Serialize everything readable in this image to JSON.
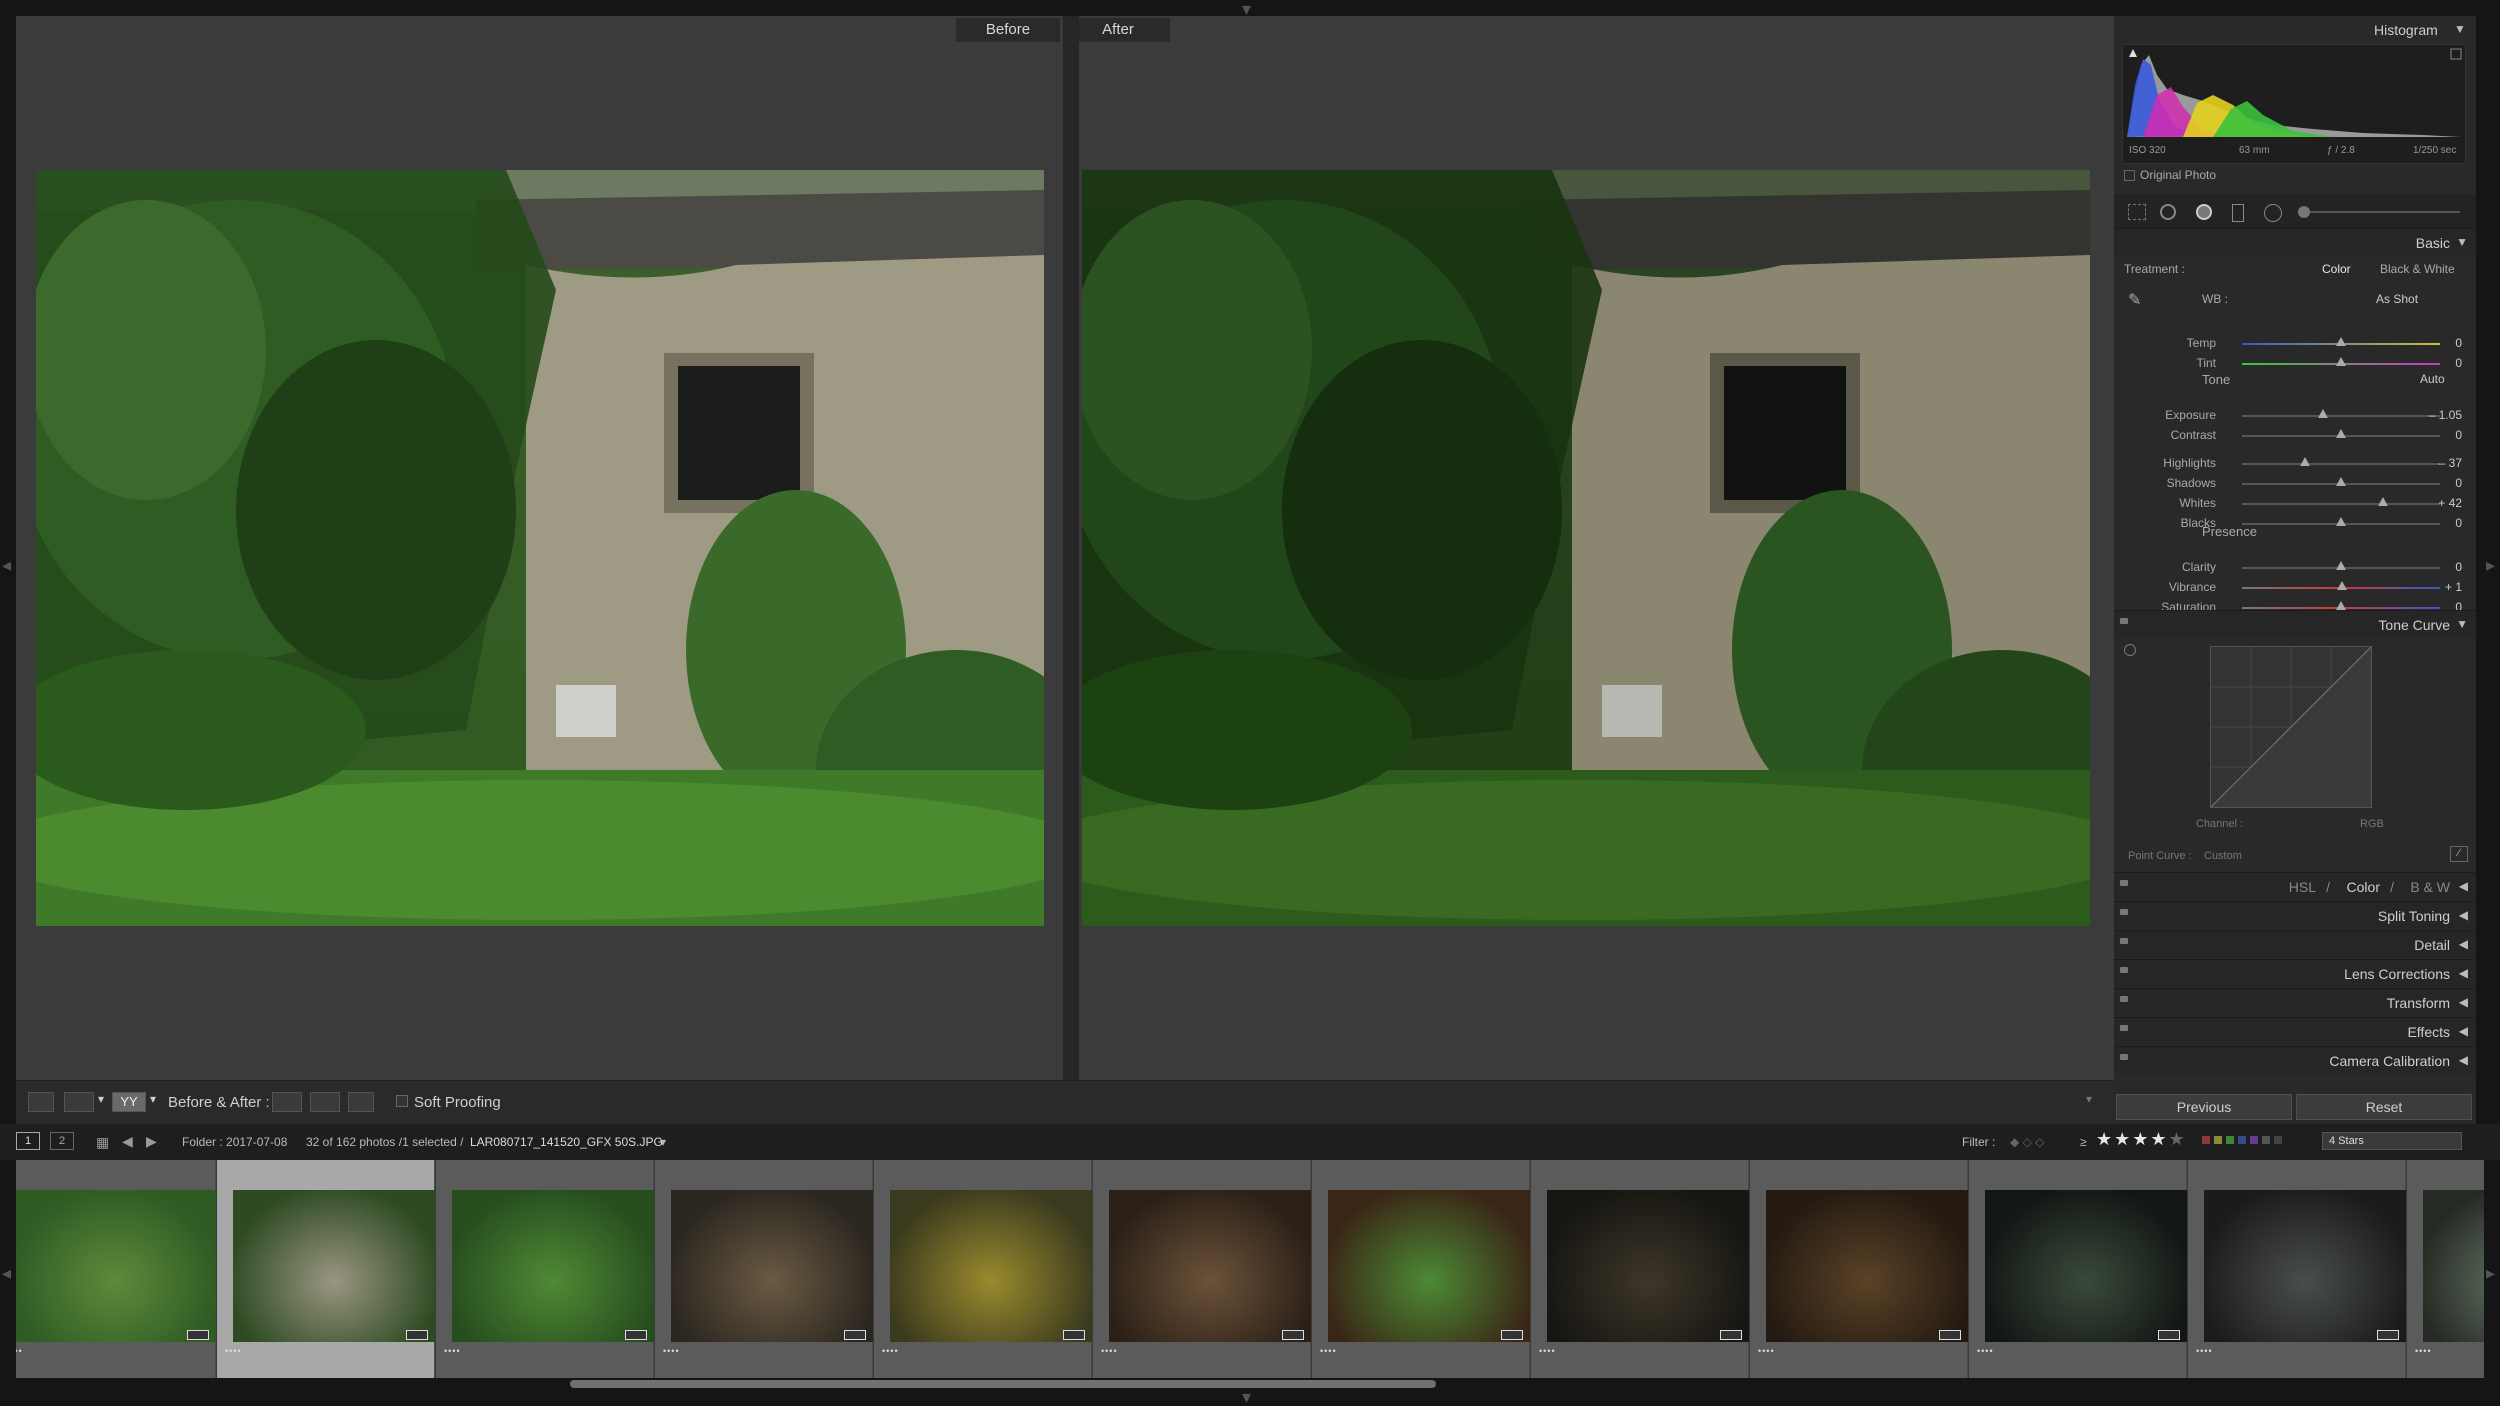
{
  "viewer": {
    "before_label": "Before",
    "after_label": "After"
  },
  "toolbar": {
    "before_after_label": "Before & After :",
    "soft_proofing_label": "Soft Proofing",
    "view_mode": "YY"
  },
  "histogram": {
    "title": "Histogram",
    "iso": "ISO 320",
    "focal": "63 mm",
    "aperture": "ƒ / 2.8",
    "shutter": "1/250 sec",
    "original_photo_label": "Original Photo"
  },
  "basic": {
    "title": "Basic",
    "treatment_label": "Treatment :",
    "treatment_color": "Color",
    "treatment_bw": "Black & White",
    "wb_label": "WB :",
    "wb_value": "As Shot",
    "tone_label": "Tone",
    "auto_label": "Auto",
    "presence_label": "Presence",
    "sliders": [
      {
        "name": "Temp",
        "value": "0",
        "pos": 0.5
      },
      {
        "name": "Tint",
        "value": "0",
        "pos": 0.5
      },
      {
        "name": "Exposure",
        "value": "– 1.05",
        "pos": 0.41
      },
      {
        "name": "Contrast",
        "value": "0",
        "pos": 0.5
      },
      {
        "name": "Highlights",
        "value": "– 37",
        "pos": 0.32
      },
      {
        "name": "Shadows",
        "value": "0",
        "pos": 0.5
      },
      {
        "name": "Whites",
        "value": "+ 42",
        "pos": 0.71
      },
      {
        "name": "Blacks",
        "value": "0",
        "pos": 0.5
      },
      {
        "name": "Clarity",
        "value": "0",
        "pos": 0.5
      },
      {
        "name": "Vibrance",
        "value": "+ 1",
        "pos": 0.505
      },
      {
        "name": "Saturation",
        "value": "0",
        "pos": 0.5
      }
    ]
  },
  "tone_curve": {
    "title": "Tone Curve",
    "channel_label": "Channel :",
    "channel_value": "RGB",
    "point_curve_label": "Point Curve :",
    "point_curve_value": "Custom"
  },
  "panels": {
    "hsl": "HSL",
    "color": "Color",
    "bw": "B & W",
    "split_toning": "Split Toning",
    "detail": "Detail",
    "lens_corrections": "Lens Corrections",
    "transform": "Transform",
    "effects": "Effects",
    "camera_calibration": "Camera Calibration"
  },
  "buttons": {
    "previous": "Previous",
    "reset": "Reset"
  },
  "filmstrip_bar": {
    "screen1": "1",
    "screen2": "2",
    "folder": "Folder : 2017-07-08",
    "count": "32 of 162 photos /1 selected /",
    "filename": "LAR080717_141520_GFX 50S.JPG",
    "filter_label": "Filter :",
    "filter_ge": "≥",
    "filter_value": "4 Stars"
  },
  "filmstrip": {
    "stars": "••••",
    "thumbs": [
      {
        "colors": [
          "#2e5a24",
          "#5e8a3a"
        ]
      },
      {
        "colors": [
          "#2d4a22",
          "#9a9680"
        ]
      },
      {
        "colors": [
          "#264d1e",
          "#4f8a34"
        ]
      },
      {
        "colors": [
          "#2a2620",
          "#6a5a42"
        ]
      },
      {
        "colors": [
          "#3a3a1e",
          "#9a8a2e"
        ]
      },
      {
        "colors": [
          "#2b2018",
          "#6b5238"
        ]
      },
      {
        "colors": [
          "#3a2616",
          "#4c8a34"
        ]
      },
      {
        "colors": [
          "#161612",
          "#3e3628"
        ]
      },
      {
        "colors": [
          "#241a12",
          "#5a4226"
        ]
      },
      {
        "colors": [
          "#121614",
          "#3a4a3a"
        ]
      },
      {
        "colors": [
          "#1a1c1c",
          "#4a4e4a"
        ]
      },
      {
        "colors": [
          "#262a24",
          "#6a7a6a"
        ]
      }
    ]
  },
  "colors": {
    "accent": "#d6d6d6",
    "panel_bg": "#292929",
    "viewer_bg": "#3b3b3b"
  }
}
